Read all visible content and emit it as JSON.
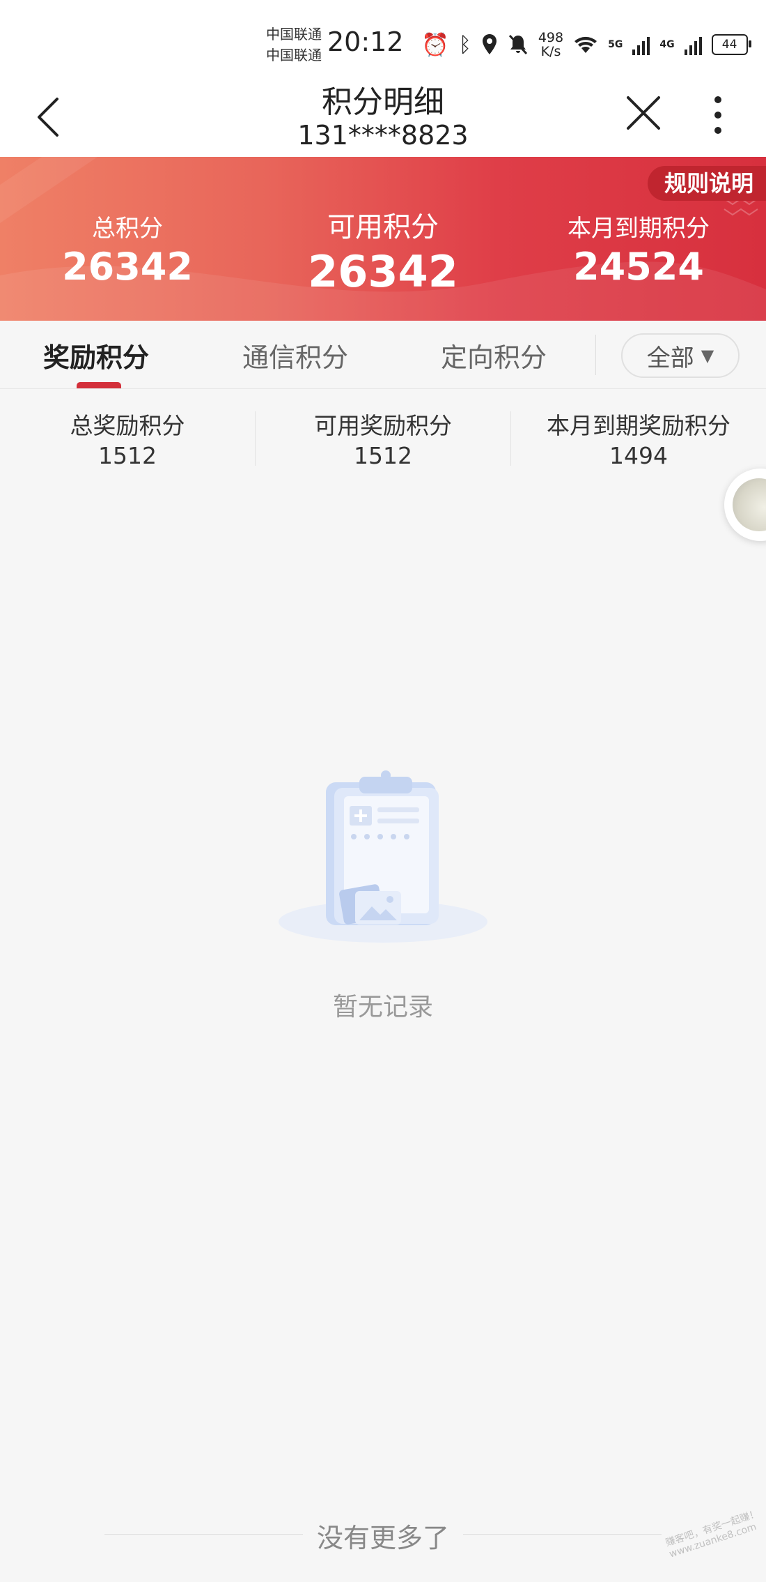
{
  "status_bar": {
    "carrier1": "中国联通",
    "carrier2": "中国联通",
    "time": "20:12",
    "net_speed_value": "498",
    "net_speed_unit": "K/s",
    "net1": "5G",
    "net2": "4G",
    "battery": "44"
  },
  "nav": {
    "title": "积分明细",
    "subtitle": "131****8823"
  },
  "banner": {
    "rule_button": "规则说明",
    "total_label": "总积分",
    "total_value": "26342",
    "available_label": "可用积分",
    "available_value": "26342",
    "expiring_label": "本月到期积分",
    "expiring_value": "24524"
  },
  "tabs": [
    {
      "label": "奖励积分",
      "active": true
    },
    {
      "label": "通信积分",
      "active": false
    },
    {
      "label": "定向积分",
      "active": false
    }
  ],
  "filter": {
    "label": "全部"
  },
  "sub_stats": [
    {
      "label": "总奖励积分",
      "value": "1512"
    },
    {
      "label": "可用奖励积分",
      "value": "1512"
    },
    {
      "label": "本月到期奖励积分",
      "value": "1494"
    }
  ],
  "empty_state": {
    "text": "暂无记录"
  },
  "footer": {
    "text": "没有更多了"
  },
  "watermark": "赚客吧，有奖一起赚！ www.zuanke8.com",
  "colors": {
    "accent": "#d32f3a",
    "banner_start": "#ef8066",
    "banner_end": "#d7303e"
  }
}
